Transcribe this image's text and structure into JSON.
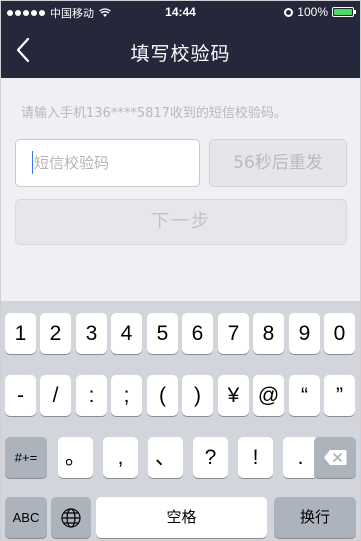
{
  "status_bar": {
    "carrier": "中国移动",
    "time": "14:44",
    "battery": "100%"
  },
  "nav": {
    "title": "填写校验码"
  },
  "hint": "请输入手机136****5817收到的短信校验码。",
  "code_input": {
    "placeholder": "短信校验码",
    "value": ""
  },
  "resend_button": "56秒后重发",
  "next_button": "下一步",
  "keyboard": {
    "row1": [
      "1",
      "2",
      "3",
      "4",
      "5",
      "6",
      "7",
      "8",
      "9",
      "0"
    ],
    "row2": [
      "-",
      "/",
      ":",
      ";",
      "(",
      ")",
      "¥",
      "@",
      "“",
      "”"
    ],
    "row3_mode": "#+=",
    "row3": [
      "。",
      ",",
      "、",
      "?",
      "!",
      "."
    ],
    "abc": "ABC",
    "space": "空格",
    "return": "换行"
  },
  "colors": {
    "navbar": "#25283a",
    "background": "#efeff4",
    "keyboard": "#d2d5db",
    "battery": "#4cd964"
  }
}
